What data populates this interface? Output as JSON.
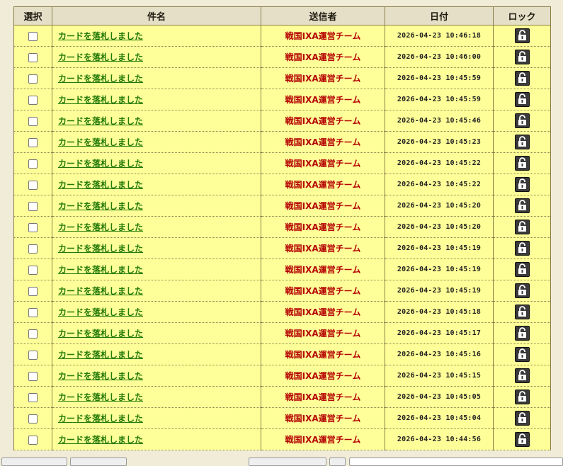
{
  "table": {
    "headers": {
      "select": "選択",
      "subject": "件名",
      "sender": "送信者",
      "date": "日付",
      "lock": "ロック"
    },
    "rows": [
      {
        "subject": "カードを落札しました",
        "sender": "戦国IXA運営チーム",
        "date": "2026-04-23 10:46:18"
      },
      {
        "subject": "カードを落札しました",
        "sender": "戦国IXA運営チーム",
        "date": "2026-04-23 10:46:00"
      },
      {
        "subject": "カードを落札しました",
        "sender": "戦国IXA運営チーム",
        "date": "2026-04-23 10:45:59"
      },
      {
        "subject": "カードを落札しました",
        "sender": "戦国IXA運営チーム",
        "date": "2026-04-23 10:45:59"
      },
      {
        "subject": "カードを落札しました",
        "sender": "戦国IXA運営チーム",
        "date": "2026-04-23 10:45:46"
      },
      {
        "subject": "カードを落札しました",
        "sender": "戦国IXA運営チーム",
        "date": "2026-04-23 10:45:23"
      },
      {
        "subject": "カードを落札しました",
        "sender": "戦国IXA運営チーム",
        "date": "2026-04-23 10:45:22"
      },
      {
        "subject": "カードを落札しました",
        "sender": "戦国IXA運営チーム",
        "date": "2026-04-23 10:45:22"
      },
      {
        "subject": "カードを落札しました",
        "sender": "戦国IXA運営チーム",
        "date": "2026-04-23 10:45:20"
      },
      {
        "subject": "カードを落札しました",
        "sender": "戦国IXA運営チーム",
        "date": "2026-04-23 10:45:20"
      },
      {
        "subject": "カードを落札しました",
        "sender": "戦国IXA運営チーム",
        "date": "2026-04-23 10:45:19"
      },
      {
        "subject": "カードを落札しました",
        "sender": "戦国IXA運営チーム",
        "date": "2026-04-23 10:45:19"
      },
      {
        "subject": "カードを落札しました",
        "sender": "戦国IXA運営チーム",
        "date": "2026-04-23 10:45:19"
      },
      {
        "subject": "カードを落札しました",
        "sender": "戦国IXA運営チーム",
        "date": "2026-04-23 10:45:18"
      },
      {
        "subject": "カードを落札しました",
        "sender": "戦国IXA運営チーム",
        "date": "2026-04-23 10:45:17"
      },
      {
        "subject": "カードを落札しました",
        "sender": "戦国IXA運営チーム",
        "date": "2026-04-23 10:45:16"
      },
      {
        "subject": "カードを落札しました",
        "sender": "戦国IXA運営チーム",
        "date": "2026-04-23 10:45:15"
      },
      {
        "subject": "カードを落札しました",
        "sender": "戦国IXA運営チーム",
        "date": "2026-04-23 10:45:05"
      },
      {
        "subject": "カードを落札しました",
        "sender": "戦国IXA運営チーム",
        "date": "2026-04-23 10:45:04"
      },
      {
        "subject": "カードを落札しました",
        "sender": "戦国IXA運営チーム",
        "date": "2026-04-23 10:44:56"
      }
    ],
    "lock_icon": "unlocked-padlock-icon"
  },
  "colors": {
    "row_background": "#ffff99",
    "header_background": "#e5dfc8",
    "subject_link": "#237a08",
    "sender_text": "#b40000",
    "page_background": "#f0ecd8"
  }
}
